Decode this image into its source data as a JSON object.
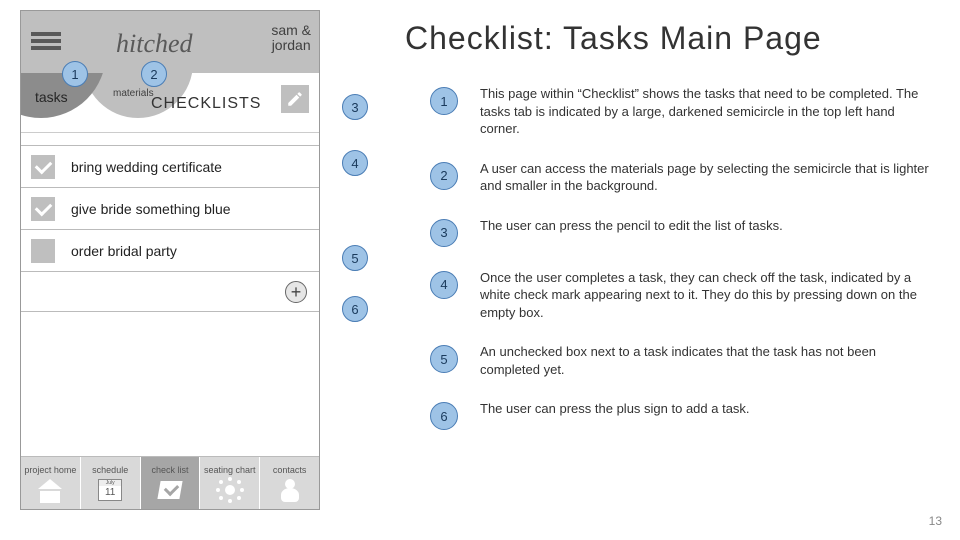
{
  "phone": {
    "logo": "hitched",
    "user_line1": "sam &",
    "user_line2": "jordan",
    "tabs": {
      "tasks": "tasks",
      "materials": "materials"
    },
    "page_title": "CHECKLISTS",
    "tasks": [
      {
        "label": "bring wedding certificate",
        "done": true
      },
      {
        "label": "give  bride something blue",
        "done": true
      },
      {
        "label": "order bridal party",
        "done": false
      }
    ],
    "calendar": {
      "month": "July",
      "day": "11"
    },
    "nav": {
      "home": "project home",
      "schedule": "schedule",
      "checklist": "check list",
      "seating": "seating chart",
      "contacts": "contacts"
    }
  },
  "title": "Checklist: Tasks Main Page",
  "annotations": [
    {
      "n": "1",
      "text": "This page within “Checklist” shows the tasks that need to be completed. The tasks tab is indicated by a large, darkened semicircle in the top left hand corner."
    },
    {
      "n": "2",
      "text": "A user can access the materials page by selecting the semicircle that is lighter and smaller in the background."
    },
    {
      "n": "3",
      "text": "The user can press the pencil to edit the list of tasks."
    },
    {
      "n": "4",
      "text": "Once the user completes a task, they can check off the task, indicated by a white check mark appearing next to it. They do this by pressing down on the empty box."
    },
    {
      "n": "5",
      "text": "An unchecked box next to a task indicates that the task has not been completed yet."
    },
    {
      "n": "6",
      "text": "The user can press the plus sign to add a task."
    }
  ],
  "page_number": "13"
}
